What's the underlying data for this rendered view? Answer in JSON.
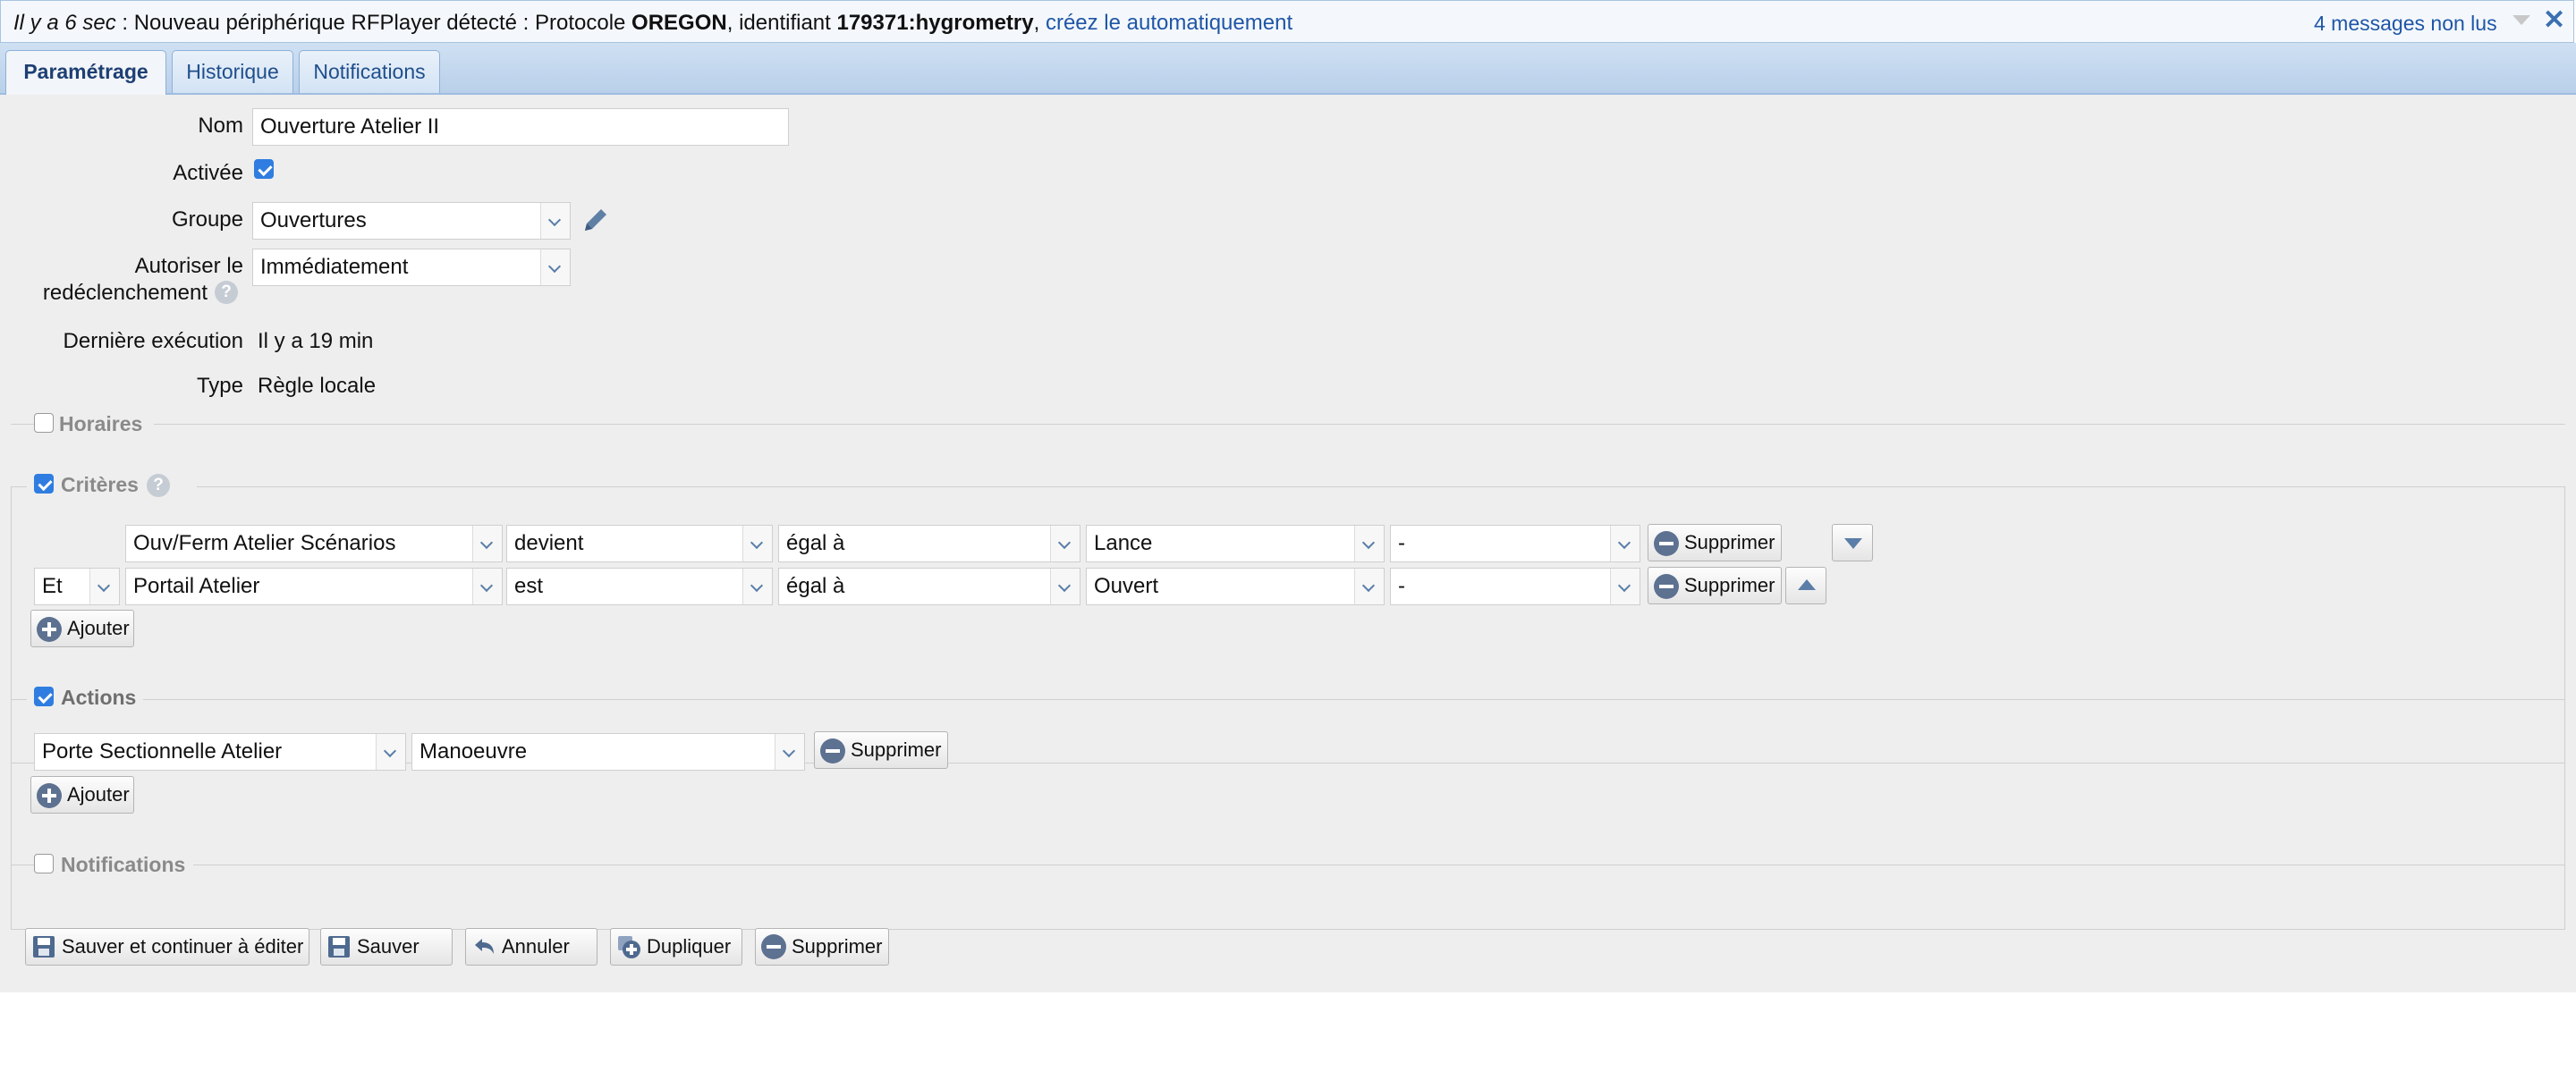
{
  "notification": {
    "time": "Il y a 6 sec",
    "separator": " : Nouveau périphérique RFPlayer détecté : Protocole ",
    "protocol": "OREGON",
    "mid": ", identifiant ",
    "identifier": "179371:hygrometry",
    "comma": ", ",
    "link": "créez le automatiquement",
    "unread": "4 messages non lus",
    "close": "✕"
  },
  "tabs": [
    {
      "label": "Paramétrage",
      "active": true
    },
    {
      "label": "Historique",
      "active": false
    },
    {
      "label": "Notifications",
      "active": false
    }
  ],
  "form": {
    "name_label": "Nom",
    "name_value": "Ouverture Atelier II",
    "active_label": "Activée",
    "active_checked": true,
    "group_label": "Groupe",
    "group_value": "Ouvertures",
    "retrigger_label_1": "Autoriser le",
    "retrigger_label_2": "redéclenchement",
    "retrigger_value": "Immédiatement",
    "last_exec_label": "Dernière exécution",
    "last_exec_value": "Il y a 19 min",
    "type_label": "Type",
    "type_value": "Règle locale"
  },
  "sections": {
    "horaires": {
      "label": "Horaires",
      "checked": false
    },
    "criteres": {
      "label": "Critères",
      "checked": true
    },
    "actions": {
      "label": "Actions",
      "checked": true
    },
    "notifications": {
      "label": "Notifications",
      "checked": false
    }
  },
  "criteria": [
    {
      "connector": "",
      "device": "Ouv/Ferm Atelier Scénarios",
      "event": "devient",
      "operator": "égal à",
      "value": "Lance",
      "extra": "-",
      "delete": "Supprimer"
    },
    {
      "connector": "Et",
      "device": "Portail Atelier",
      "event": "est",
      "operator": "égal à",
      "value": "Ouvert",
      "extra": "-",
      "delete": "Supprimer"
    }
  ],
  "criteria_add": "Ajouter",
  "actions": [
    {
      "device": "Porte Sectionnelle Atelier",
      "command": "Manoeuvre",
      "delete": "Supprimer"
    }
  ],
  "actions_add": "Ajouter",
  "footer": {
    "save_continue": "Sauver et continuer à éditer",
    "save": "Sauver",
    "cancel": "Annuler",
    "duplicate": "Dupliquer",
    "delete": "Supprimer"
  },
  "icons": [
    "chevron-down-icon",
    "close-icon",
    "pencil-icon",
    "help-icon",
    "minus-circle-icon",
    "plus-circle-icon",
    "save-icon",
    "undo-icon",
    "duplicate-icon"
  ],
  "colors": {
    "link": "#1f56a6",
    "checkbox": "#2f7de1",
    "tab_bar": "#c4d8ee",
    "panel": "#eeeeee"
  }
}
